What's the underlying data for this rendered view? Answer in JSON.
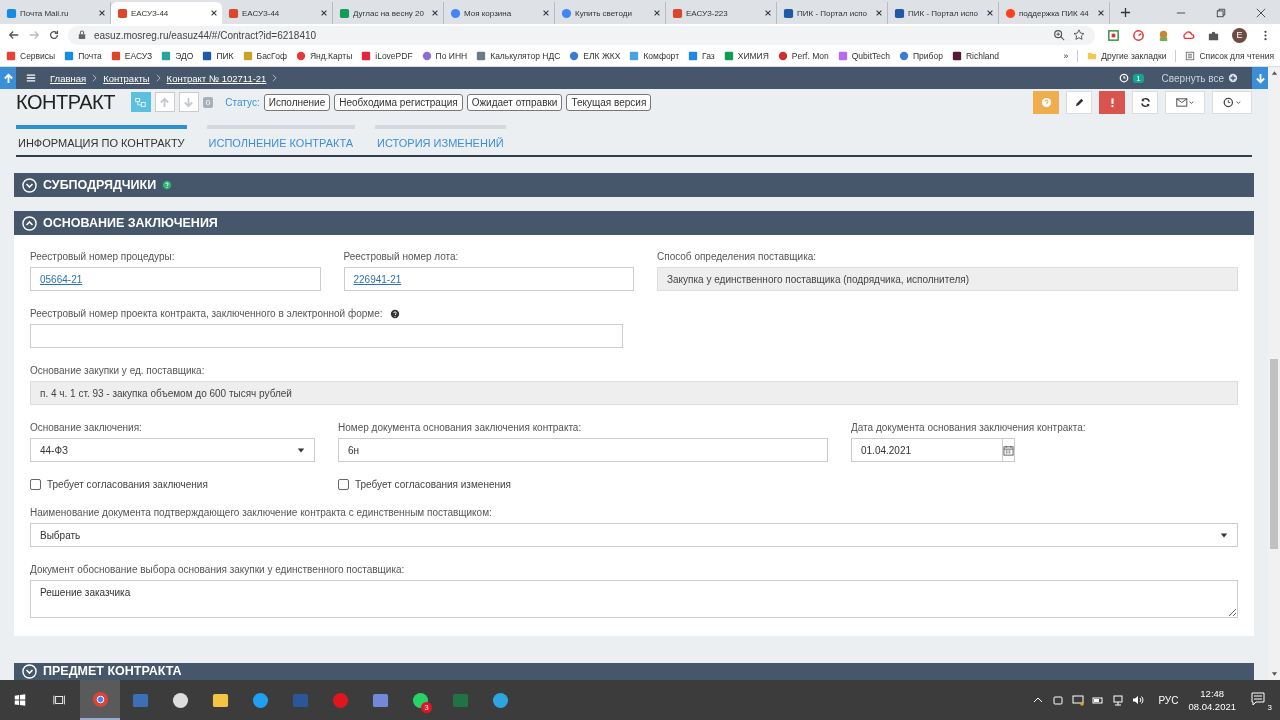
{
  "browser": {
    "tabs": [
      {
        "title": "Почта Mail.ru",
        "kind": "mail",
        "selected": false
      },
      {
        "title": "ЕАСУЗ-44",
        "kind": "emblem",
        "selected": true
      },
      {
        "title": "ЕАСУЗ-44",
        "kind": "emblem",
        "selected": false
      },
      {
        "title": "Дуглас на весну 20",
        "kind": "sheet",
        "selected": false
      },
      {
        "title": "Моя корзина",
        "kind": "google",
        "selected": false
      },
      {
        "title": "Купить светоди",
        "kind": "google",
        "selected": false
      },
      {
        "title": "ЕАСУЗ-223",
        "kind": "emblem",
        "selected": false
      },
      {
        "title": "ПИК - Портал испо",
        "kind": "pik",
        "selected": false
      },
      {
        "title": "ПИК - Портал испо",
        "kind": "pik",
        "selected": false
      },
      {
        "title": "поддержка ПИК 44",
        "kind": "yandex",
        "selected": false
      }
    ],
    "address": "easuz.mosreg.ru/easuz44/#/Contract?id=6218410",
    "profile": "E",
    "bookmarks": [
      {
        "label": "Сервисы",
        "kind": "apps"
      },
      {
        "label": "Почта",
        "kind": "mail"
      },
      {
        "label": "ЕАСУЗ",
        "kind": "emblem"
      },
      {
        "label": "ЭДО",
        "kind": "doc"
      },
      {
        "label": "ПИК",
        "kind": "pik"
      },
      {
        "label": "БасГоф",
        "kind": "eagle"
      },
      {
        "label": "Янд.Карты",
        "kind": "pin"
      },
      {
        "label": "iLovePDF",
        "kind": "heart"
      },
      {
        "label": "По ИНН",
        "kind": "finger"
      },
      {
        "label": "Калькулятор НДС",
        "kind": "calc"
      },
      {
        "label": "ЕЛК ЖКХ",
        "kind": "globe"
      },
      {
        "label": "Комфорт",
        "kind": "wave"
      },
      {
        "label": "Газ",
        "kind": "flame"
      },
      {
        "label": "ХИМИЯ",
        "kind": "sheet"
      },
      {
        "label": "Perf. Mon",
        "kind": "red"
      },
      {
        "label": "QubitTech",
        "kind": "purple"
      },
      {
        "label": "Прибор",
        "kind": "globe"
      },
      {
        "label": "Richland",
        "kind": "dark"
      }
    ],
    "more": "»",
    "other_bookmarks": "Другие закладки",
    "reading_list": "Список для чтения"
  },
  "app": {
    "breadcrumbs": [
      "Главная",
      "Контракты",
      "Контракт № 102711-21"
    ],
    "notifications": "1",
    "collapse_all": "Свернуть все",
    "title": "КОНТРАКТ",
    "counter": "0",
    "status_label": "Статус:",
    "statuses": [
      "Исполнение",
      "Необходима регистрация",
      "Ожидает отправки",
      "Текущая версия"
    ],
    "tabs": [
      {
        "label": "ИНФОРМАЦИЯ ПО КОНТРАКТУ",
        "selected": true
      },
      {
        "label": "ИСПОЛНЕНИЕ КОНТРАКТА",
        "selected": false
      },
      {
        "label": "ИСТОРИЯ ИЗМЕНЕНИЙ",
        "selected": false
      }
    ],
    "sections": [
      {
        "title": "СУБПОДРЯДЧИКИ",
        "expanded": false,
        "help": true
      },
      {
        "title": "ОСНОВАНИЕ ЗАКЛЮЧЕНИЯ",
        "expanded": true,
        "rows": [
          {
            "fields": [
              {
                "kind": "link",
                "label": "Реестровый номер процедуры:",
                "value": "05664-21"
              },
              {
                "kind": "link",
                "label": "Реестровый номер лота:",
                "value": "226941-21"
              },
              {
                "kind": "readonly",
                "label": "Способ определения поставщика:",
                "value": "Закупка у единственного поставщика (подрядчика, исполнителя)"
              }
            ]
          },
          {
            "fields": [
              {
                "kind": "text",
                "label": "Реестровый номер проекта контракта, заключенного в электронной форме:",
                "help": true
              }
            ]
          },
          {
            "fields": [
              {
                "kind": "readonly",
                "label": "Основание закупки у ед. поставщика:",
                "value": "п. 4 ч. 1 ст. 93 - закупка объемом до 600 тысяч рублей"
              }
            ]
          },
          {
            "fields": [
              {
                "kind": "select",
                "label": "Основание заключения:",
                "value": "44-ФЗ"
              },
              {
                "kind": "text",
                "label": "Номер документа основания заключения контракта:",
                "value": "6н"
              },
              {
                "kind": "date",
                "label": "Дата документа основания заключения контракта:",
                "value": "01.04.2021"
              }
            ]
          },
          {
            "fields": [
              {
                "kind": "checkbox",
                "label": "Требует согласования заключения",
                "checked": false
              },
              {
                "kind": "checkbox",
                "label": "Требует согласования изменения",
                "checked": false
              }
            ]
          },
          {
            "fields": [
              {
                "kind": "select",
                "label": "Наименование документа подтверждающего заключение контракта с единственным поставщиком:",
                "placeholder": "Выбрать"
              }
            ]
          },
          {
            "fields": [
              {
                "kind": "textarea",
                "label": "Документ обоснование выбора основания закупки у единственного поставщика:",
                "value": "Решение заказчика"
              }
            ]
          }
        ]
      },
      {
        "title": "ПРЕДМЕТ КОНТРАКТА",
        "expanded": false
      }
    ]
  },
  "taskbar": {
    "apps": [
      {
        "kind": "chrome",
        "active": true
      },
      {
        "kind": "calc",
        "active": false
      },
      {
        "kind": "settings",
        "active": false
      },
      {
        "kind": "folder",
        "active": false
      },
      {
        "kind": "ie",
        "active": false
      },
      {
        "kind": "word",
        "active": false
      },
      {
        "kind": "opera",
        "active": false
      },
      {
        "kind": "discord",
        "active": false
      },
      {
        "kind": "whatsapp",
        "active": false,
        "badge": "3"
      },
      {
        "kind": "excel",
        "active": false
      },
      {
        "kind": "telegram",
        "active": false
      }
    ],
    "language": "РУС",
    "time": "12:48",
    "date": "08.04.2021",
    "notifications": "3"
  }
}
